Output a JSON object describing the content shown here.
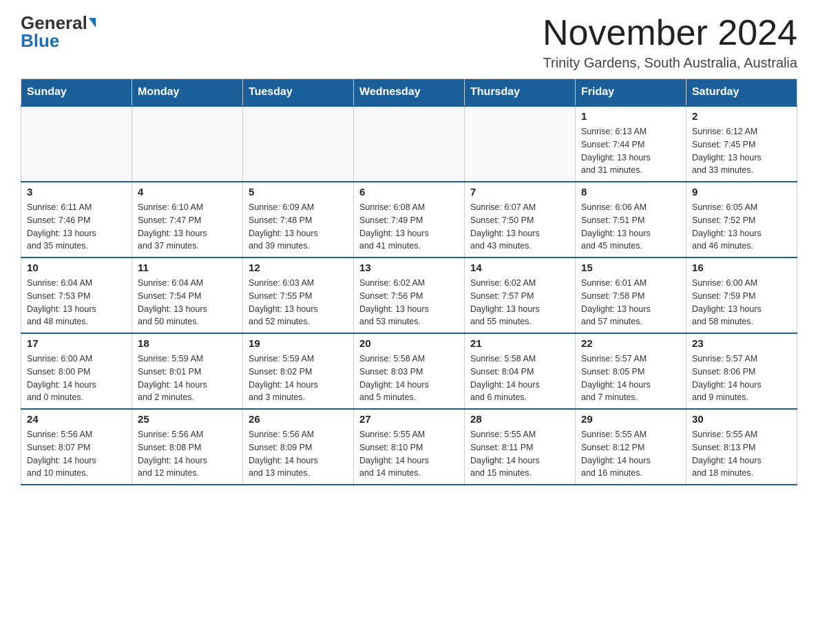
{
  "header": {
    "logo_general": "General",
    "logo_blue": "Blue",
    "month_title": "November 2024",
    "location": "Trinity Gardens, South Australia, Australia"
  },
  "weekdays": [
    "Sunday",
    "Monday",
    "Tuesday",
    "Wednesday",
    "Thursday",
    "Friday",
    "Saturday"
  ],
  "weeks": [
    [
      {
        "day": "",
        "info": ""
      },
      {
        "day": "",
        "info": ""
      },
      {
        "day": "",
        "info": ""
      },
      {
        "day": "",
        "info": ""
      },
      {
        "day": "",
        "info": ""
      },
      {
        "day": "1",
        "info": "Sunrise: 6:13 AM\nSunset: 7:44 PM\nDaylight: 13 hours\nand 31 minutes."
      },
      {
        "day": "2",
        "info": "Sunrise: 6:12 AM\nSunset: 7:45 PM\nDaylight: 13 hours\nand 33 minutes."
      }
    ],
    [
      {
        "day": "3",
        "info": "Sunrise: 6:11 AM\nSunset: 7:46 PM\nDaylight: 13 hours\nand 35 minutes."
      },
      {
        "day": "4",
        "info": "Sunrise: 6:10 AM\nSunset: 7:47 PM\nDaylight: 13 hours\nand 37 minutes."
      },
      {
        "day": "5",
        "info": "Sunrise: 6:09 AM\nSunset: 7:48 PM\nDaylight: 13 hours\nand 39 minutes."
      },
      {
        "day": "6",
        "info": "Sunrise: 6:08 AM\nSunset: 7:49 PM\nDaylight: 13 hours\nand 41 minutes."
      },
      {
        "day": "7",
        "info": "Sunrise: 6:07 AM\nSunset: 7:50 PM\nDaylight: 13 hours\nand 43 minutes."
      },
      {
        "day": "8",
        "info": "Sunrise: 6:06 AM\nSunset: 7:51 PM\nDaylight: 13 hours\nand 45 minutes."
      },
      {
        "day": "9",
        "info": "Sunrise: 6:05 AM\nSunset: 7:52 PM\nDaylight: 13 hours\nand 46 minutes."
      }
    ],
    [
      {
        "day": "10",
        "info": "Sunrise: 6:04 AM\nSunset: 7:53 PM\nDaylight: 13 hours\nand 48 minutes."
      },
      {
        "day": "11",
        "info": "Sunrise: 6:04 AM\nSunset: 7:54 PM\nDaylight: 13 hours\nand 50 minutes."
      },
      {
        "day": "12",
        "info": "Sunrise: 6:03 AM\nSunset: 7:55 PM\nDaylight: 13 hours\nand 52 minutes."
      },
      {
        "day": "13",
        "info": "Sunrise: 6:02 AM\nSunset: 7:56 PM\nDaylight: 13 hours\nand 53 minutes."
      },
      {
        "day": "14",
        "info": "Sunrise: 6:02 AM\nSunset: 7:57 PM\nDaylight: 13 hours\nand 55 minutes."
      },
      {
        "day": "15",
        "info": "Sunrise: 6:01 AM\nSunset: 7:58 PM\nDaylight: 13 hours\nand 57 minutes."
      },
      {
        "day": "16",
        "info": "Sunrise: 6:00 AM\nSunset: 7:59 PM\nDaylight: 13 hours\nand 58 minutes."
      }
    ],
    [
      {
        "day": "17",
        "info": "Sunrise: 6:00 AM\nSunset: 8:00 PM\nDaylight: 14 hours\nand 0 minutes."
      },
      {
        "day": "18",
        "info": "Sunrise: 5:59 AM\nSunset: 8:01 PM\nDaylight: 14 hours\nand 2 minutes."
      },
      {
        "day": "19",
        "info": "Sunrise: 5:59 AM\nSunset: 8:02 PM\nDaylight: 14 hours\nand 3 minutes."
      },
      {
        "day": "20",
        "info": "Sunrise: 5:58 AM\nSunset: 8:03 PM\nDaylight: 14 hours\nand 5 minutes."
      },
      {
        "day": "21",
        "info": "Sunrise: 5:58 AM\nSunset: 8:04 PM\nDaylight: 14 hours\nand 6 minutes."
      },
      {
        "day": "22",
        "info": "Sunrise: 5:57 AM\nSunset: 8:05 PM\nDaylight: 14 hours\nand 7 minutes."
      },
      {
        "day": "23",
        "info": "Sunrise: 5:57 AM\nSunset: 8:06 PM\nDaylight: 14 hours\nand 9 minutes."
      }
    ],
    [
      {
        "day": "24",
        "info": "Sunrise: 5:56 AM\nSunset: 8:07 PM\nDaylight: 14 hours\nand 10 minutes."
      },
      {
        "day": "25",
        "info": "Sunrise: 5:56 AM\nSunset: 8:08 PM\nDaylight: 14 hours\nand 12 minutes."
      },
      {
        "day": "26",
        "info": "Sunrise: 5:56 AM\nSunset: 8:09 PM\nDaylight: 14 hours\nand 13 minutes."
      },
      {
        "day": "27",
        "info": "Sunrise: 5:55 AM\nSunset: 8:10 PM\nDaylight: 14 hours\nand 14 minutes."
      },
      {
        "day": "28",
        "info": "Sunrise: 5:55 AM\nSunset: 8:11 PM\nDaylight: 14 hours\nand 15 minutes."
      },
      {
        "day": "29",
        "info": "Sunrise: 5:55 AM\nSunset: 8:12 PM\nDaylight: 14 hours\nand 16 minutes."
      },
      {
        "day": "30",
        "info": "Sunrise: 5:55 AM\nSunset: 8:13 PM\nDaylight: 14 hours\nand 18 minutes."
      }
    ]
  ]
}
